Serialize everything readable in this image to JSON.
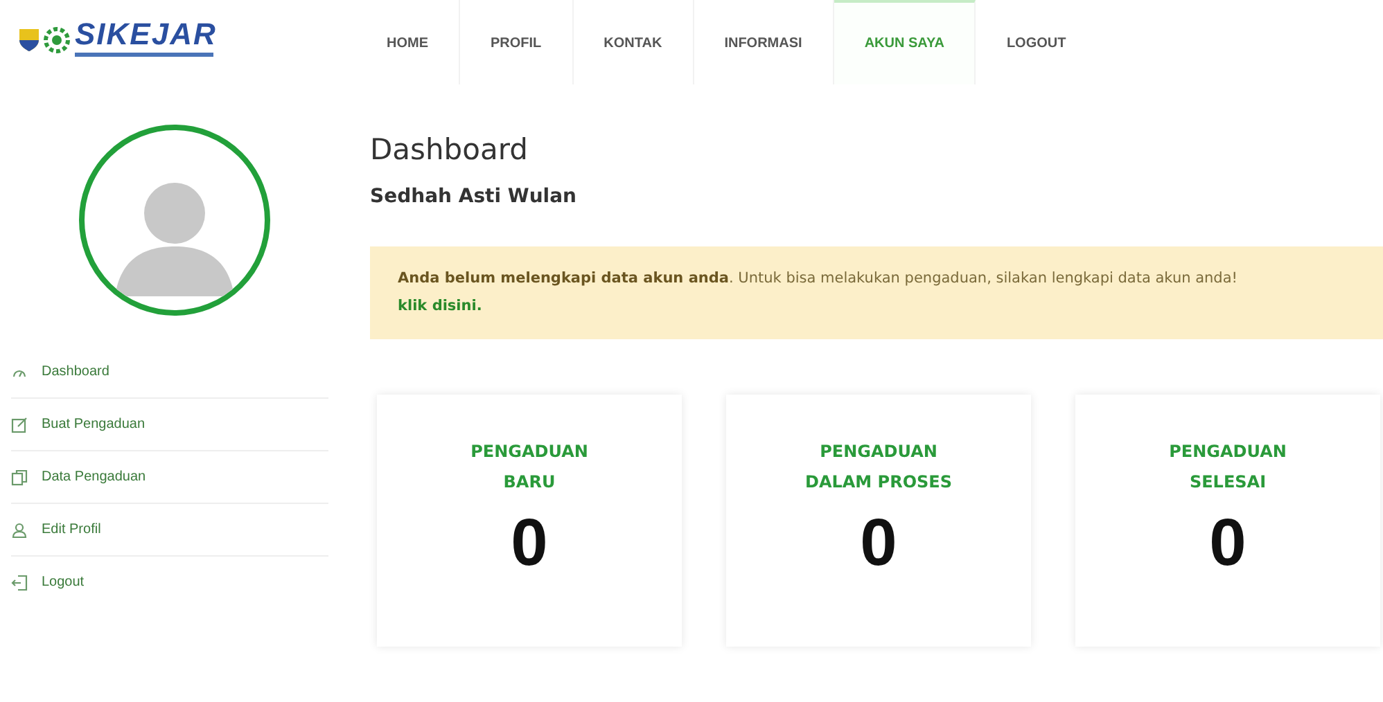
{
  "logo": {
    "text": "SIKEJAR"
  },
  "nav": [
    {
      "label": "HOME",
      "selected": false
    },
    {
      "label": "PROFIL",
      "selected": false
    },
    {
      "label": "KONTAK",
      "selected": false
    },
    {
      "label": "INFORMASI",
      "selected": false
    },
    {
      "label": "AKUN SAYA",
      "selected": true
    },
    {
      "label": "LOGOUT",
      "selected": false
    }
  ],
  "sidebar": {
    "items": [
      {
        "label": "Dashboard",
        "kind": "gauge"
      },
      {
        "label": "Buat Pengaduan",
        "kind": "edit"
      },
      {
        "label": "Data Pengaduan",
        "kind": "copy"
      },
      {
        "label": "Edit Profil",
        "kind": "user"
      },
      {
        "label": "Logout",
        "kind": "logout"
      }
    ]
  },
  "page": {
    "title": "Dashboard",
    "user_name": "Sedhah Asti Wulan"
  },
  "alert": {
    "message": "**Anda belum melengkapi data akun anda**. Untuk bisa melakukan pengaduan, silakan lengkapi data akun anda!",
    "link": "klik disini."
  },
  "stats": [
    {
      "label": "PENGADUAN\nBARU",
      "value": "0"
    },
    {
      "label": "PENGADUAN\nDALAM PROSES",
      "value": "0"
    },
    {
      "label": "PENGADUAN\nSELESAI",
      "value": "0"
    }
  ]
}
